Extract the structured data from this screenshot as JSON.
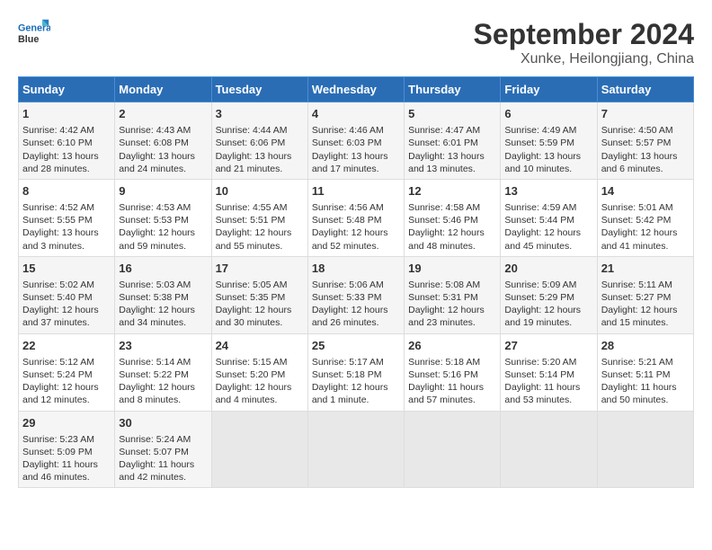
{
  "header": {
    "logo_line1": "General",
    "logo_line2": "Blue",
    "month": "September 2024",
    "location": "Xunke, Heilongjiang, China"
  },
  "weekdays": [
    "Sunday",
    "Monday",
    "Tuesday",
    "Wednesday",
    "Thursday",
    "Friday",
    "Saturday"
  ],
  "weeks": [
    [
      {
        "day": "1",
        "lines": [
          "Sunrise: 4:42 AM",
          "Sunset: 6:10 PM",
          "Daylight: 13 hours",
          "and 28 minutes."
        ]
      },
      {
        "day": "2",
        "lines": [
          "Sunrise: 4:43 AM",
          "Sunset: 6:08 PM",
          "Daylight: 13 hours",
          "and 24 minutes."
        ]
      },
      {
        "day": "3",
        "lines": [
          "Sunrise: 4:44 AM",
          "Sunset: 6:06 PM",
          "Daylight: 13 hours",
          "and 21 minutes."
        ]
      },
      {
        "day": "4",
        "lines": [
          "Sunrise: 4:46 AM",
          "Sunset: 6:03 PM",
          "Daylight: 13 hours",
          "and 17 minutes."
        ]
      },
      {
        "day": "5",
        "lines": [
          "Sunrise: 4:47 AM",
          "Sunset: 6:01 PM",
          "Daylight: 13 hours",
          "and 13 minutes."
        ]
      },
      {
        "day": "6",
        "lines": [
          "Sunrise: 4:49 AM",
          "Sunset: 5:59 PM",
          "Daylight: 13 hours",
          "and 10 minutes."
        ]
      },
      {
        "day": "7",
        "lines": [
          "Sunrise: 4:50 AM",
          "Sunset: 5:57 PM",
          "Daylight: 13 hours",
          "and 6 minutes."
        ]
      }
    ],
    [
      {
        "day": "8",
        "lines": [
          "Sunrise: 4:52 AM",
          "Sunset: 5:55 PM",
          "Daylight: 13 hours",
          "and 3 minutes."
        ]
      },
      {
        "day": "9",
        "lines": [
          "Sunrise: 4:53 AM",
          "Sunset: 5:53 PM",
          "Daylight: 12 hours",
          "and 59 minutes."
        ]
      },
      {
        "day": "10",
        "lines": [
          "Sunrise: 4:55 AM",
          "Sunset: 5:51 PM",
          "Daylight: 12 hours",
          "and 55 minutes."
        ]
      },
      {
        "day": "11",
        "lines": [
          "Sunrise: 4:56 AM",
          "Sunset: 5:48 PM",
          "Daylight: 12 hours",
          "and 52 minutes."
        ]
      },
      {
        "day": "12",
        "lines": [
          "Sunrise: 4:58 AM",
          "Sunset: 5:46 PM",
          "Daylight: 12 hours",
          "and 48 minutes."
        ]
      },
      {
        "day": "13",
        "lines": [
          "Sunrise: 4:59 AM",
          "Sunset: 5:44 PM",
          "Daylight: 12 hours",
          "and 45 minutes."
        ]
      },
      {
        "day": "14",
        "lines": [
          "Sunrise: 5:01 AM",
          "Sunset: 5:42 PM",
          "Daylight: 12 hours",
          "and 41 minutes."
        ]
      }
    ],
    [
      {
        "day": "15",
        "lines": [
          "Sunrise: 5:02 AM",
          "Sunset: 5:40 PM",
          "Daylight: 12 hours",
          "and 37 minutes."
        ]
      },
      {
        "day": "16",
        "lines": [
          "Sunrise: 5:03 AM",
          "Sunset: 5:38 PM",
          "Daylight: 12 hours",
          "and 34 minutes."
        ]
      },
      {
        "day": "17",
        "lines": [
          "Sunrise: 5:05 AM",
          "Sunset: 5:35 PM",
          "Daylight: 12 hours",
          "and 30 minutes."
        ]
      },
      {
        "day": "18",
        "lines": [
          "Sunrise: 5:06 AM",
          "Sunset: 5:33 PM",
          "Daylight: 12 hours",
          "and 26 minutes."
        ]
      },
      {
        "day": "19",
        "lines": [
          "Sunrise: 5:08 AM",
          "Sunset: 5:31 PM",
          "Daylight: 12 hours",
          "and 23 minutes."
        ]
      },
      {
        "day": "20",
        "lines": [
          "Sunrise: 5:09 AM",
          "Sunset: 5:29 PM",
          "Daylight: 12 hours",
          "and 19 minutes."
        ]
      },
      {
        "day": "21",
        "lines": [
          "Sunrise: 5:11 AM",
          "Sunset: 5:27 PM",
          "Daylight: 12 hours",
          "and 15 minutes."
        ]
      }
    ],
    [
      {
        "day": "22",
        "lines": [
          "Sunrise: 5:12 AM",
          "Sunset: 5:24 PM",
          "Daylight: 12 hours",
          "and 12 minutes."
        ]
      },
      {
        "day": "23",
        "lines": [
          "Sunrise: 5:14 AM",
          "Sunset: 5:22 PM",
          "Daylight: 12 hours",
          "and 8 minutes."
        ]
      },
      {
        "day": "24",
        "lines": [
          "Sunrise: 5:15 AM",
          "Sunset: 5:20 PM",
          "Daylight: 12 hours",
          "and 4 minutes."
        ]
      },
      {
        "day": "25",
        "lines": [
          "Sunrise: 5:17 AM",
          "Sunset: 5:18 PM",
          "Daylight: 12 hours",
          "and 1 minute."
        ]
      },
      {
        "day": "26",
        "lines": [
          "Sunrise: 5:18 AM",
          "Sunset: 5:16 PM",
          "Daylight: 11 hours",
          "and 57 minutes."
        ]
      },
      {
        "day": "27",
        "lines": [
          "Sunrise: 5:20 AM",
          "Sunset: 5:14 PM",
          "Daylight: 11 hours",
          "and 53 minutes."
        ]
      },
      {
        "day": "28",
        "lines": [
          "Sunrise: 5:21 AM",
          "Sunset: 5:11 PM",
          "Daylight: 11 hours",
          "and 50 minutes."
        ]
      }
    ],
    [
      {
        "day": "29",
        "lines": [
          "Sunrise: 5:23 AM",
          "Sunset: 5:09 PM",
          "Daylight: 11 hours",
          "and 46 minutes."
        ]
      },
      {
        "day": "30",
        "lines": [
          "Sunrise: 5:24 AM",
          "Sunset: 5:07 PM",
          "Daylight: 11 hours",
          "and 42 minutes."
        ]
      },
      null,
      null,
      null,
      null,
      null
    ]
  ]
}
